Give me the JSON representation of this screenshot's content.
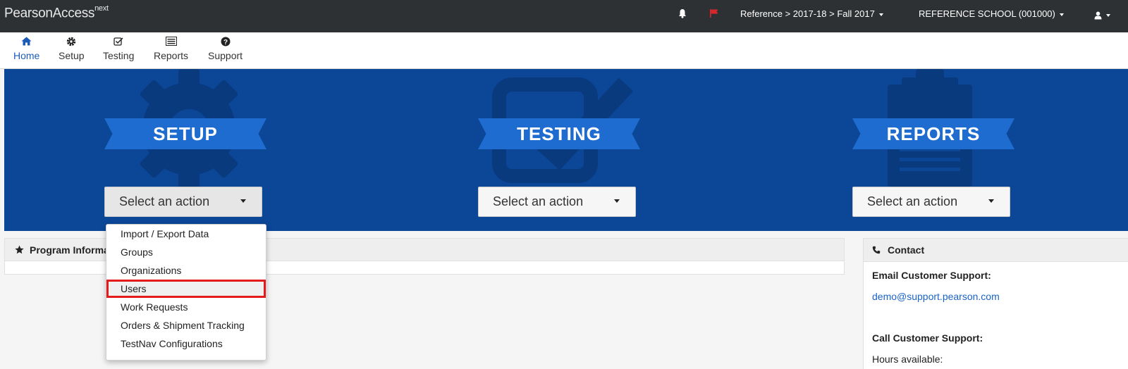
{
  "topbar": {
    "logo_main": "PearsonAccess",
    "logo_sup": "next",
    "breadcrumb": "Reference > 2017-18 > Fall 2017",
    "organization": "REFERENCE SCHOOL (001000)",
    "icons": [
      "bell-icon",
      "flag-icon",
      "user-icon"
    ]
  },
  "nav": {
    "items": [
      {
        "label": "Home",
        "icon": "home-icon",
        "active": true
      },
      {
        "label": "Setup",
        "icon": "gear-icon"
      },
      {
        "label": "Testing",
        "icon": "checkbox-icon"
      },
      {
        "label": "Reports",
        "icon": "list-icon"
      },
      {
        "label": "Support",
        "icon": "question-icon"
      }
    ]
  },
  "hero": {
    "setup": {
      "title": "SETUP",
      "select": "Select an action"
    },
    "testing": {
      "title": "TESTING",
      "select": "Select an action"
    },
    "reports": {
      "title": "REPORTS",
      "select": "Select an action"
    }
  },
  "setup_menu": {
    "items": [
      "Import / Export Data",
      "Groups",
      "Organizations",
      "Users",
      "Work Requests",
      "Orders & Shipment Tracking",
      "TestNav Configurations"
    ],
    "highlighted": "Users"
  },
  "program_info": {
    "title": "Program Information"
  },
  "contact": {
    "title": "Contact",
    "email_label": "Email Customer Support:",
    "email": "demo@support.pearson.com",
    "call_label": "Call Customer Support:",
    "hours_label": "Hours available:"
  },
  "colors": {
    "topbar": "#2e3134",
    "hero": "#0c4697",
    "ribbon": "#1f6cd1",
    "highlight_border": "#e51a1a",
    "link": "#1a63c9",
    "flag": "#d9262c"
  }
}
